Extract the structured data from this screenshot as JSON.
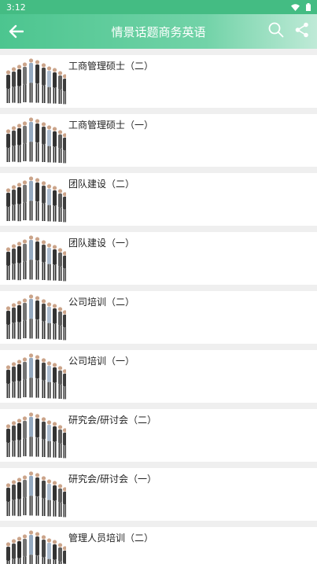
{
  "status_bar": {
    "time": "3:12"
  },
  "app_bar": {
    "title": "情景话题商务英语"
  },
  "items": [
    {
      "label": "工商管理硕士（二）"
    },
    {
      "label": "工商管理硕士（一）"
    },
    {
      "label": "团队建设（二）"
    },
    {
      "label": "团队建设（一）"
    },
    {
      "label": "公司培训（二）"
    },
    {
      "label": "公司培训（一）"
    },
    {
      "label": "研究会/研讨会（二）"
    },
    {
      "label": "研究会/研讨会（一）"
    },
    {
      "label": "管理人员培训（二）"
    }
  ],
  "colors": {
    "accent": "#4cc58f"
  }
}
